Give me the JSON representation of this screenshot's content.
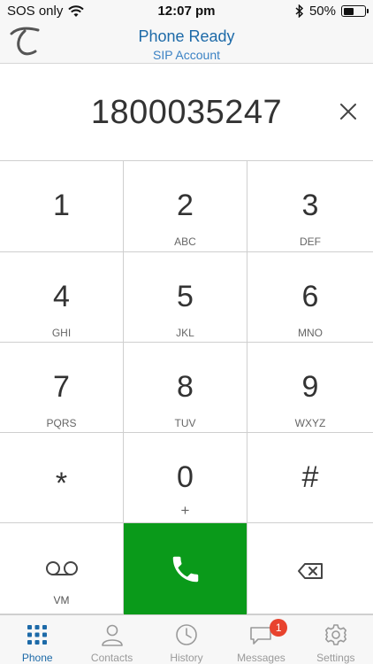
{
  "status_bar": {
    "carrier": "SOS only",
    "time": "12:07 pm",
    "battery": "50%",
    "battery_level": 0.5
  },
  "header": {
    "title": "Phone Ready",
    "subtitle": "SIP Account"
  },
  "dialer": {
    "number": "1800035247"
  },
  "keypad": [
    {
      "digit": "1",
      "letters": ""
    },
    {
      "digit": "2",
      "letters": "ABC"
    },
    {
      "digit": "3",
      "letters": "DEF"
    },
    {
      "digit": "4",
      "letters": "GHI"
    },
    {
      "digit": "5",
      "letters": "JKL"
    },
    {
      "digit": "6",
      "letters": "MNO"
    },
    {
      "digit": "7",
      "letters": "PQRS"
    },
    {
      "digit": "8",
      "letters": "TUV"
    },
    {
      "digit": "9",
      "letters": "WXYZ"
    },
    {
      "digit": "*",
      "letters": ""
    },
    {
      "digit": "0",
      "letters": "+"
    },
    {
      "digit": "#",
      "letters": ""
    }
  ],
  "actions": {
    "voicemail_label": "VM"
  },
  "tabs": [
    {
      "label": "Phone",
      "icon": "keypad-grid-icon"
    },
    {
      "label": "Contacts",
      "icon": "person-icon"
    },
    {
      "label": "History",
      "icon": "clock-icon"
    },
    {
      "label": "Messages",
      "icon": "chat-bubble-icon",
      "badge": "1"
    },
    {
      "label": "Settings",
      "icon": "gear-icon"
    }
  ],
  "colors": {
    "accent": "#1d6aa8",
    "call_green": "#0a9a1a",
    "badge_red": "#e8432e"
  }
}
